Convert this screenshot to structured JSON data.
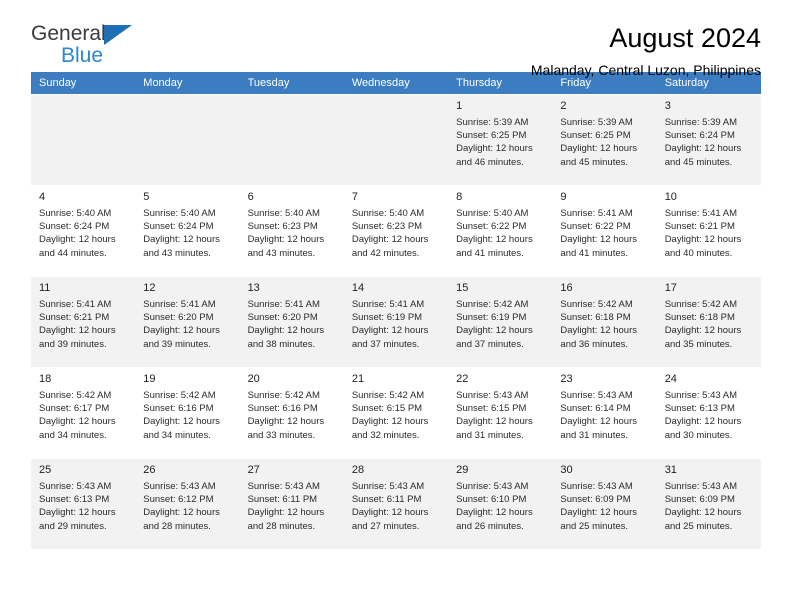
{
  "brand": {
    "name_top": "General",
    "name_bottom": "Blue",
    "triangle_color": "#1f6fb5",
    "blue_color": "#2a87d0"
  },
  "header": {
    "title": "August 2024",
    "subtitle": "Malanday, Central Luzon, Philippines"
  },
  "theme": {
    "header_row_bg": "#3b7dc0",
    "header_row_text": "#ffffff",
    "shaded_row_bg": "#f2f2f2",
    "plain_row_bg": "#ffffff"
  },
  "weekday_headers": [
    "Sunday",
    "Monday",
    "Tuesday",
    "Wednesday",
    "Thursday",
    "Friday",
    "Saturday"
  ],
  "weeks": [
    {
      "shaded": true,
      "days": [
        {
          "num": "",
          "sunrise": "",
          "sunset": "",
          "daylight_line1": "",
          "daylight_line2": "",
          "empty": true
        },
        {
          "num": "",
          "sunrise": "",
          "sunset": "",
          "daylight_line1": "",
          "daylight_line2": "",
          "empty": true
        },
        {
          "num": "",
          "sunrise": "",
          "sunset": "",
          "daylight_line1": "",
          "daylight_line2": "",
          "empty": true
        },
        {
          "num": "",
          "sunrise": "",
          "sunset": "",
          "daylight_line1": "",
          "daylight_line2": "",
          "empty": true
        },
        {
          "num": "1",
          "sunrise": "Sunrise: 5:39 AM",
          "sunset": "Sunset: 6:25 PM",
          "daylight_line1": "Daylight: 12 hours",
          "daylight_line2": "and 46 minutes.",
          "empty": false
        },
        {
          "num": "2",
          "sunrise": "Sunrise: 5:39 AM",
          "sunset": "Sunset: 6:25 PM",
          "daylight_line1": "Daylight: 12 hours",
          "daylight_line2": "and 45 minutes.",
          "empty": false
        },
        {
          "num": "3",
          "sunrise": "Sunrise: 5:39 AM",
          "sunset": "Sunset: 6:24 PM",
          "daylight_line1": "Daylight: 12 hours",
          "daylight_line2": "and 45 minutes.",
          "empty": false
        }
      ]
    },
    {
      "shaded": false,
      "days": [
        {
          "num": "4",
          "sunrise": "Sunrise: 5:40 AM",
          "sunset": "Sunset: 6:24 PM",
          "daylight_line1": "Daylight: 12 hours",
          "daylight_line2": "and 44 minutes.",
          "empty": false
        },
        {
          "num": "5",
          "sunrise": "Sunrise: 5:40 AM",
          "sunset": "Sunset: 6:24 PM",
          "daylight_line1": "Daylight: 12 hours",
          "daylight_line2": "and 43 minutes.",
          "empty": false
        },
        {
          "num": "6",
          "sunrise": "Sunrise: 5:40 AM",
          "sunset": "Sunset: 6:23 PM",
          "daylight_line1": "Daylight: 12 hours",
          "daylight_line2": "and 43 minutes.",
          "empty": false
        },
        {
          "num": "7",
          "sunrise": "Sunrise: 5:40 AM",
          "sunset": "Sunset: 6:23 PM",
          "daylight_line1": "Daylight: 12 hours",
          "daylight_line2": "and 42 minutes.",
          "empty": false
        },
        {
          "num": "8",
          "sunrise": "Sunrise: 5:40 AM",
          "sunset": "Sunset: 6:22 PM",
          "daylight_line1": "Daylight: 12 hours",
          "daylight_line2": "and 41 minutes.",
          "empty": false
        },
        {
          "num": "9",
          "sunrise": "Sunrise: 5:41 AM",
          "sunset": "Sunset: 6:22 PM",
          "daylight_line1": "Daylight: 12 hours",
          "daylight_line2": "and 41 minutes.",
          "empty": false
        },
        {
          "num": "10",
          "sunrise": "Sunrise: 5:41 AM",
          "sunset": "Sunset: 6:21 PM",
          "daylight_line1": "Daylight: 12 hours",
          "daylight_line2": "and 40 minutes.",
          "empty": false
        }
      ]
    },
    {
      "shaded": true,
      "days": [
        {
          "num": "11",
          "sunrise": "Sunrise: 5:41 AM",
          "sunset": "Sunset: 6:21 PM",
          "daylight_line1": "Daylight: 12 hours",
          "daylight_line2": "and 39 minutes.",
          "empty": false
        },
        {
          "num": "12",
          "sunrise": "Sunrise: 5:41 AM",
          "sunset": "Sunset: 6:20 PM",
          "daylight_line1": "Daylight: 12 hours",
          "daylight_line2": "and 39 minutes.",
          "empty": false
        },
        {
          "num": "13",
          "sunrise": "Sunrise: 5:41 AM",
          "sunset": "Sunset: 6:20 PM",
          "daylight_line1": "Daylight: 12 hours",
          "daylight_line2": "and 38 minutes.",
          "empty": false
        },
        {
          "num": "14",
          "sunrise": "Sunrise: 5:41 AM",
          "sunset": "Sunset: 6:19 PM",
          "daylight_line1": "Daylight: 12 hours",
          "daylight_line2": "and 37 minutes.",
          "empty": false
        },
        {
          "num": "15",
          "sunrise": "Sunrise: 5:42 AM",
          "sunset": "Sunset: 6:19 PM",
          "daylight_line1": "Daylight: 12 hours",
          "daylight_line2": "and 37 minutes.",
          "empty": false
        },
        {
          "num": "16",
          "sunrise": "Sunrise: 5:42 AM",
          "sunset": "Sunset: 6:18 PM",
          "daylight_line1": "Daylight: 12 hours",
          "daylight_line2": "and 36 minutes.",
          "empty": false
        },
        {
          "num": "17",
          "sunrise": "Sunrise: 5:42 AM",
          "sunset": "Sunset: 6:18 PM",
          "daylight_line1": "Daylight: 12 hours",
          "daylight_line2": "and 35 minutes.",
          "empty": false
        }
      ]
    },
    {
      "shaded": false,
      "days": [
        {
          "num": "18",
          "sunrise": "Sunrise: 5:42 AM",
          "sunset": "Sunset: 6:17 PM",
          "daylight_line1": "Daylight: 12 hours",
          "daylight_line2": "and 34 minutes.",
          "empty": false
        },
        {
          "num": "19",
          "sunrise": "Sunrise: 5:42 AM",
          "sunset": "Sunset: 6:16 PM",
          "daylight_line1": "Daylight: 12 hours",
          "daylight_line2": "and 34 minutes.",
          "empty": false
        },
        {
          "num": "20",
          "sunrise": "Sunrise: 5:42 AM",
          "sunset": "Sunset: 6:16 PM",
          "daylight_line1": "Daylight: 12 hours",
          "daylight_line2": "and 33 minutes.",
          "empty": false
        },
        {
          "num": "21",
          "sunrise": "Sunrise: 5:42 AM",
          "sunset": "Sunset: 6:15 PM",
          "daylight_line1": "Daylight: 12 hours",
          "daylight_line2": "and 32 minutes.",
          "empty": false
        },
        {
          "num": "22",
          "sunrise": "Sunrise: 5:43 AM",
          "sunset": "Sunset: 6:15 PM",
          "daylight_line1": "Daylight: 12 hours",
          "daylight_line2": "and 31 minutes.",
          "empty": false
        },
        {
          "num": "23",
          "sunrise": "Sunrise: 5:43 AM",
          "sunset": "Sunset: 6:14 PM",
          "daylight_line1": "Daylight: 12 hours",
          "daylight_line2": "and 31 minutes.",
          "empty": false
        },
        {
          "num": "24",
          "sunrise": "Sunrise: 5:43 AM",
          "sunset": "Sunset: 6:13 PM",
          "daylight_line1": "Daylight: 12 hours",
          "daylight_line2": "and 30 minutes.",
          "empty": false
        }
      ]
    },
    {
      "shaded": true,
      "days": [
        {
          "num": "25",
          "sunrise": "Sunrise: 5:43 AM",
          "sunset": "Sunset: 6:13 PM",
          "daylight_line1": "Daylight: 12 hours",
          "daylight_line2": "and 29 minutes.",
          "empty": false
        },
        {
          "num": "26",
          "sunrise": "Sunrise: 5:43 AM",
          "sunset": "Sunset: 6:12 PM",
          "daylight_line1": "Daylight: 12 hours",
          "daylight_line2": "and 28 minutes.",
          "empty": false
        },
        {
          "num": "27",
          "sunrise": "Sunrise: 5:43 AM",
          "sunset": "Sunset: 6:11 PM",
          "daylight_line1": "Daylight: 12 hours",
          "daylight_line2": "and 28 minutes.",
          "empty": false
        },
        {
          "num": "28",
          "sunrise": "Sunrise: 5:43 AM",
          "sunset": "Sunset: 6:11 PM",
          "daylight_line1": "Daylight: 12 hours",
          "daylight_line2": "and 27 minutes.",
          "empty": false
        },
        {
          "num": "29",
          "sunrise": "Sunrise: 5:43 AM",
          "sunset": "Sunset: 6:10 PM",
          "daylight_line1": "Daylight: 12 hours",
          "daylight_line2": "and 26 minutes.",
          "empty": false
        },
        {
          "num": "30",
          "sunrise": "Sunrise: 5:43 AM",
          "sunset": "Sunset: 6:09 PM",
          "daylight_line1": "Daylight: 12 hours",
          "daylight_line2": "and 25 minutes.",
          "empty": false
        },
        {
          "num": "31",
          "sunrise": "Sunrise: 5:43 AM",
          "sunset": "Sunset: 6:09 PM",
          "daylight_line1": "Daylight: 12 hours",
          "daylight_line2": "and 25 minutes.",
          "empty": false
        }
      ]
    }
  ]
}
